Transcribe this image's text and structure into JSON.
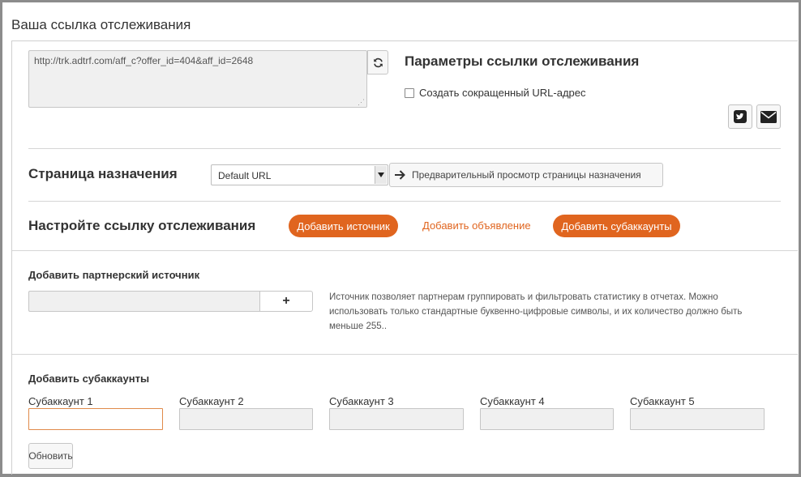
{
  "header": {
    "title": "Ваша ссылка отслеживания"
  },
  "tracking_link": {
    "url": "http://trk.adtrf.com/aff_c?offer_id=404&aff_id=2648"
  },
  "params": {
    "title": "Параметры ссылки отслеживания",
    "shorten_label": "Создать сокращенный URL-адрес",
    "shorten_checked": false
  },
  "icons": {
    "refresh": "refresh-icon",
    "twitter": "twitter-icon",
    "email": "envelope-icon",
    "preview": "arrow-right-icon"
  },
  "destination": {
    "title": "Страница назначения",
    "select_value": "Default URL",
    "preview_label": "Предварительный просмотр страницы назначения"
  },
  "configure": {
    "title": "Настройте ссылку отслеживания",
    "add_source_label": "Добавить источник",
    "add_ad_label": "Добавить объявление",
    "add_subaccounts_label": "Добавить субаккаунты"
  },
  "partner_source": {
    "title": "Добавить партнерский источник",
    "input_value": "",
    "add_label": "+",
    "help_line1": "Источник позволяет партнерам группировать и фильтровать статистику в отчетах. Можно",
    "help_line2": "использовать только стандартные буквенно-цифровые символы, и их количество должно быть",
    "help_line3": "меньше 255.."
  },
  "subaccounts": {
    "title": "Добавить субаккаунты",
    "fields": [
      {
        "label": "Субаккаунт 1",
        "value": ""
      },
      {
        "label": "Субаккаунт 2",
        "value": ""
      },
      {
        "label": "Субаккаунт 3",
        "value": ""
      },
      {
        "label": "Субаккаунт 4",
        "value": ""
      },
      {
        "label": "Субаккаунт 5",
        "value": ""
      }
    ],
    "update_label": "Обновить"
  },
  "colors": {
    "accent": "#e0651f",
    "frame": "#8c8c8c",
    "input_bg": "#f0f0f0"
  }
}
